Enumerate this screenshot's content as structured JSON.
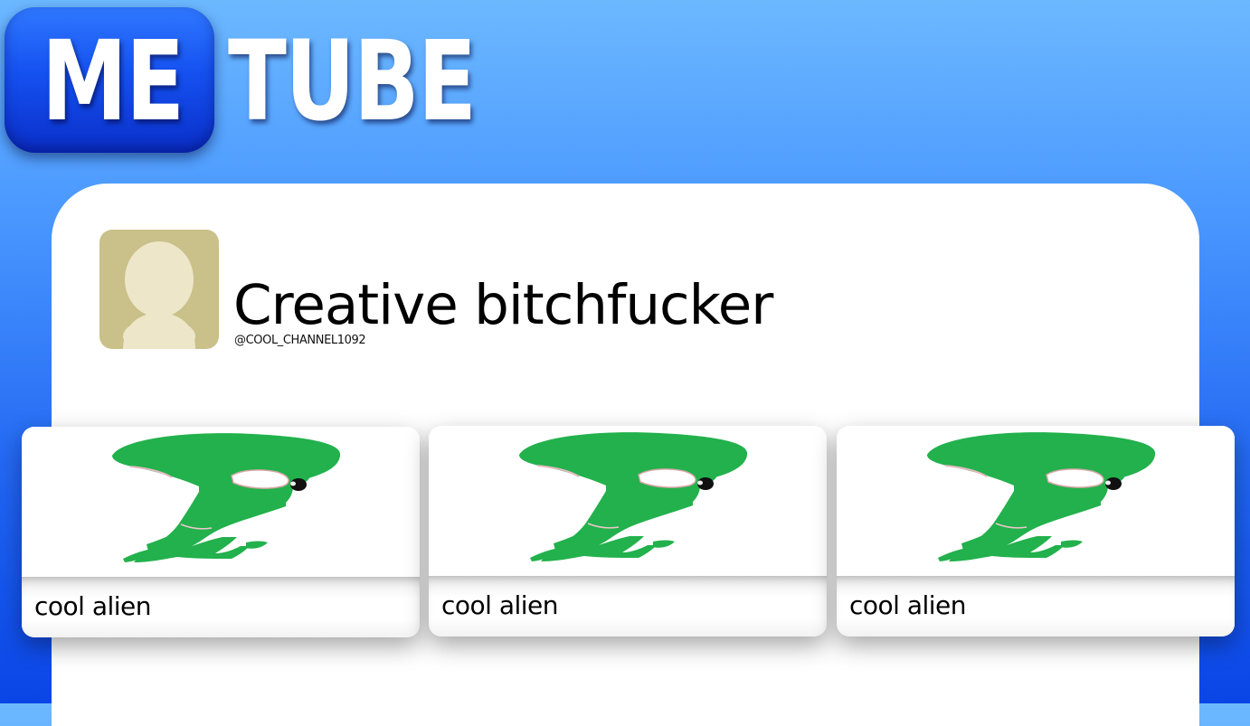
{
  "logo": {
    "part1": "ME",
    "part2": "TUBE"
  },
  "channel": {
    "name": "Creative bitchfucker",
    "handle": "@COOL_CHANNEL1092",
    "avatar_icon": "default-user-avatar-icon"
  },
  "videos": [
    {
      "title": "cool alien",
      "thumbnail_icon": "green-alien-drawing"
    },
    {
      "title": "cool alien",
      "thumbnail_icon": "green-alien-drawing"
    },
    {
      "title": "cool alien",
      "thumbnail_icon": "green-alien-drawing"
    }
  ],
  "colors": {
    "background_top": "#6cb8ff",
    "background_bottom": "#0a45e6",
    "logo_badge": "#1551f0",
    "avatar_bg": "#c9c08a",
    "avatar_silhouette": "#ede6c8",
    "alien_green": "#22b14c"
  }
}
